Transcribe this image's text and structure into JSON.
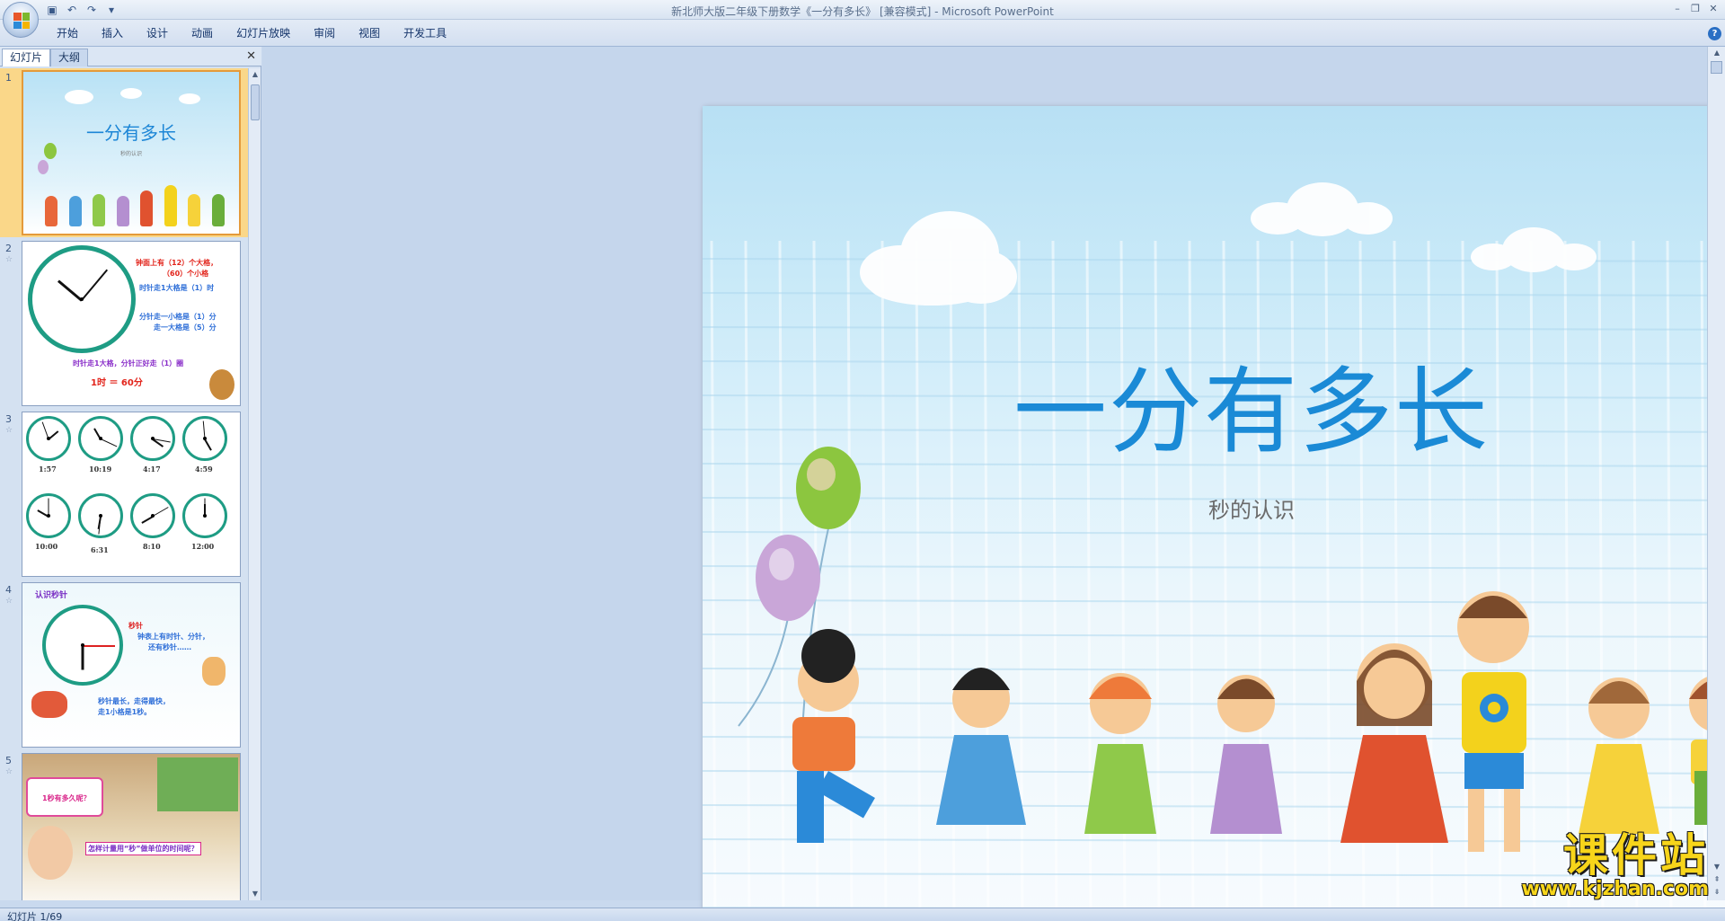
{
  "window": {
    "title": "新北师大版二年级下册数学《一分有多长》 [兼容模式] - Microsoft PowerPoint",
    "controls": [
      "–",
      "❐",
      "✕"
    ]
  },
  "quick_access": [
    {
      "name": "save-icon",
      "glyph": "▣"
    },
    {
      "name": "undo-icon",
      "glyph": "↶"
    },
    {
      "name": "redo-icon",
      "glyph": "↷"
    },
    {
      "name": "customize-icon",
      "glyph": "▾"
    }
  ],
  "ribbon": {
    "tabs": [
      "开始",
      "插入",
      "设计",
      "动画",
      "幻灯片放映",
      "审阅",
      "视图",
      "开发工具"
    ],
    "help": "?"
  },
  "panel": {
    "tab_slides": "幻灯片",
    "tab_outline": "大纲",
    "close": "✕"
  },
  "thumbnails": [
    {
      "num": "1",
      "title": "一分有多长",
      "subtitle": "秒的认识"
    },
    {
      "num": "2",
      "star": "☆",
      "lines": [
        "钟面上有（12）个大格，",
        "（60）个小格",
        "时针走1大格是（1）时",
        "分针走一小格是（1）分",
        "走一大格是（5）分",
        "时针走1大格，分针正好走（1）圈",
        "1时 ＝ 60分"
      ]
    },
    {
      "num": "3",
      "star": "☆",
      "times": [
        "1:57",
        "10:19",
        "4:17",
        "4:59",
        "10:00",
        "6:31",
        "8:10",
        "12:00"
      ]
    },
    {
      "num": "4",
      "star": "☆",
      "lines": [
        "认识秒针",
        "秒针",
        "钟表上有时针、分针，",
        "还有秒针……",
        "秒针最长，走得最快，",
        "走1小格是1秒。"
      ]
    },
    {
      "num": "5",
      "star": "☆",
      "lines": [
        "1秒有多久呢？",
        "怎样计量用“秒”做单位的时间呢？"
      ]
    }
  ],
  "slide": {
    "title": "一分有多长",
    "subtitle": "秒的认识"
  },
  "status": {
    "slide_counter": "幻灯片 1/69"
  },
  "watermark": {
    "top": "课件站",
    "bottom": "www.kjzhan.com"
  },
  "colors": {
    "title_blue": "#1a8ad6",
    "clock_green": "#1e9c84",
    "watermark_yellow": "#f7d51a",
    "selection_orange": "#fad789"
  }
}
